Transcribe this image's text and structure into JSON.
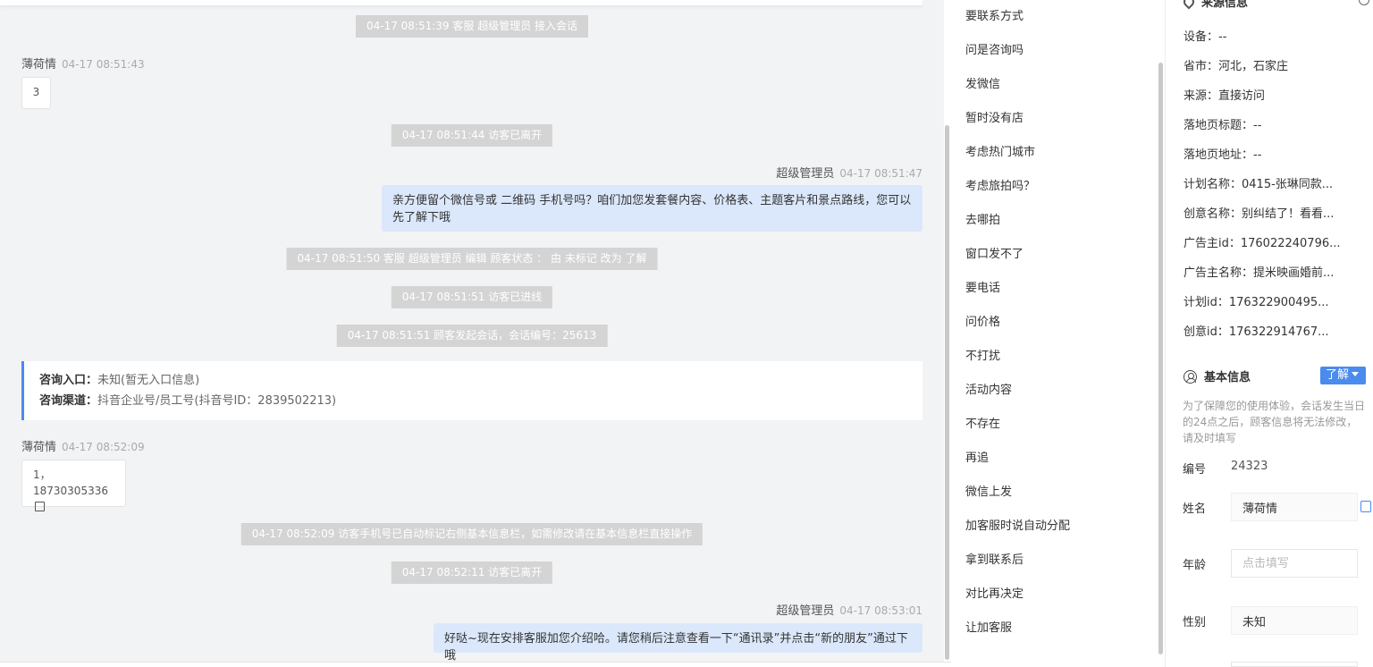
{
  "chat": {
    "system_messages": [
      "04-17 08:51:39 客服 超级管理员 接入会话",
      "04-17 08:51:44 访客已离开",
      "04-17 08:51:50 客服 超级管理员 编辑 顾客状态 ： 由 未标记 改为 了解",
      "04-17 08:51:51 访客已进线",
      "04-17 08:51:51 顾客发起会话，会话编号：25613",
      "04-17 08:52:09 访客手机号已自动标记右侧基本信息栏，如需修改请在基本信息栏直接操作",
      "04-17 08:52:11 访客已离开"
    ],
    "visitor_name": "薄荷情",
    "agent_name": "超级管理员",
    "messages": [
      {
        "time": "04-17 08:51:43",
        "text": "3"
      },
      {
        "time": "04-17 08:51:47",
        "text": "亲方便留个微信号或 二维码 手机号吗？咱们加您发套餐内容、价格表、主题客片和景点路线，您可以先了解下哦"
      },
      {
        "time": "04-17 08:52:09",
        "line1": "1，",
        "line2": "18730305336"
      },
      {
        "time": "04-17 08:53:01",
        "text": "好哒~现在安排客服加您介绍哈。请您稍后注意查看一下“通讯录”并点击“新的朋友”通过下哦"
      }
    ],
    "consult_card": {
      "entry_label": "咨询入口：",
      "entry_value": "未知(暂无入口信息)",
      "channel_label": "咨询渠道：",
      "channel_value": "抖音企业号/员工号(抖音号ID：2839502213)"
    }
  },
  "quick_replies": [
    "要联系方式",
    "问是咨询吗",
    "发微信",
    "暂时没有店",
    "考虑热门城市",
    "考虑旅拍吗？",
    "去哪拍",
    "窗口发不了",
    "要电话",
    "问价格",
    "不打扰",
    "活动内容",
    "不存在",
    "再追",
    "微信上发",
    "加客服时说自动分配",
    "拿到联系后",
    "对比再决定",
    "让加客服"
  ],
  "source_info": {
    "title": "来源信息",
    "rows": [
      "设备：--",
      "省市：河北，石家庄",
      "来源：直接访问",
      "落地页标题：--",
      "落地页地址：--",
      "计划名称：0415-张琳同款...",
      "创意名称：别纠结了！看看...",
      "广告主id：176022240796...",
      "广告主名称：提米映画婚前...",
      "计划id：176322900495...",
      "创意id：176322914767..."
    ]
  },
  "basic_info": {
    "title": "基本信息",
    "status_tag": "了解",
    "notice": "为了保障您的使用体验，会话发生当日的24点之后，顾客信息将无法修改，请及时填写",
    "id_label": "编号",
    "id_value": "24323",
    "name_label": "姓名",
    "name_value": "薄荷情",
    "age_label": "年龄",
    "age_placeholder": "点击填写",
    "gender_label": "性别",
    "gender_value": "未知"
  },
  "colors": {
    "accent": "#4a8bee",
    "agent_bubble": "#dbe8fb",
    "system_pill": "#d4d4d4"
  }
}
